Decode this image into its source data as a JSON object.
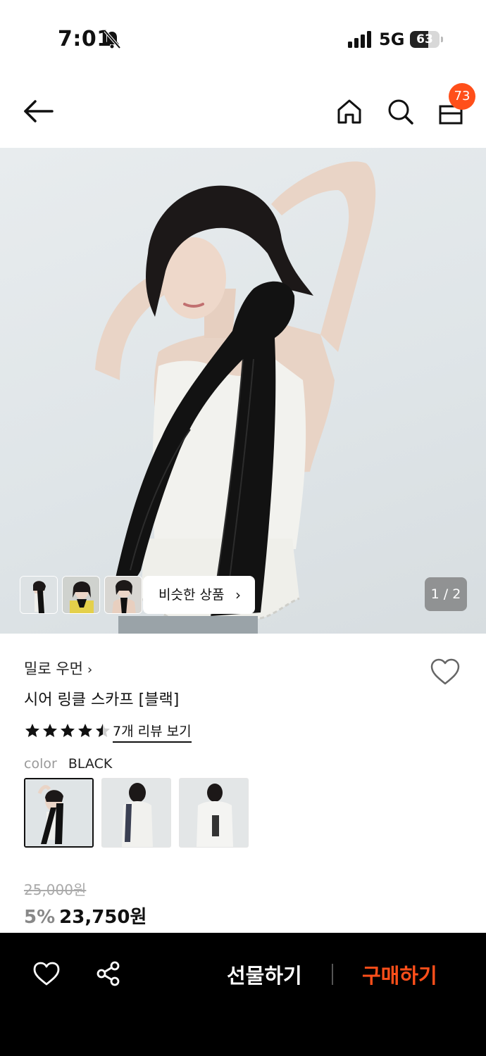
{
  "status_bar": {
    "time": "7:01",
    "network": "5G",
    "battery": "63",
    "battery_level": 0.63
  },
  "header": {
    "cart_count": "73"
  },
  "gallery": {
    "similar_label": "비슷한 상품",
    "page_indicator": "1 / 2"
  },
  "product": {
    "brand": "밀로 우먼",
    "title": "시어 링클 스카프 [블랙]",
    "rating": 4.5,
    "review_link": "7개 리뷰 보기",
    "color_label": "color",
    "color_value": "BLACK",
    "original_price": "25,000원",
    "discount": "5%",
    "sale_price": "23,750원"
  },
  "bottom_bar": {
    "gift_label": "선물하기",
    "buy_label": "구매하기"
  },
  "colors": {
    "accent": "#ff4f1a",
    "bottom_bar_bg": "#000000"
  },
  "icons": [
    "bell-slash-icon",
    "signal-icon",
    "back-arrow-icon",
    "home-icon",
    "search-icon",
    "shopping-bag-icon",
    "heart-icon",
    "share-icon",
    "chevron-right-icon",
    "star-icon"
  ]
}
